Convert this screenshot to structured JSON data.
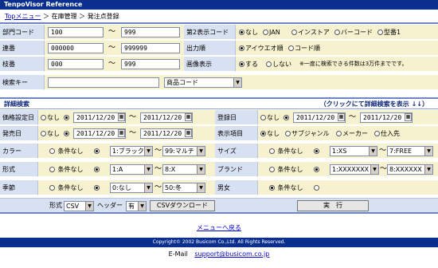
{
  "app_title": "TenpoVisor Reference",
  "breadcrumb": {
    "home": "Topメニュー",
    "sep1": "＞",
    "item1": "在庫管理",
    "sep2": "＞",
    "item2": "発注点登録"
  },
  "basic": {
    "dept": {
      "label": "部門コード",
      "from": "100",
      "tilde": "〜",
      "to": "999"
    },
    "serial": {
      "label": "連番",
      "from": "000000",
      "tilde": "〜",
      "to": "999999"
    },
    "trunk": {
      "label": "枝番",
      "from": "000",
      "tilde": "〜",
      "to": "999"
    },
    "search_key": {
      "label": "検索キー",
      "value": "",
      "select": "商品コード"
    },
    "second_code": {
      "label": "第2表示コード",
      "options": [
        "なし",
        "JAN",
        "インストア",
        "バーコード",
        "型番1"
      ],
      "selected": 0
    },
    "output_order": {
      "label": "出力順",
      "options": [
        "アイウエオ順",
        "コード順"
      ],
      "selected": 0
    },
    "image_display": {
      "label": "画像表示",
      "options": [
        "する",
        "しない"
      ],
      "selected": 0,
      "note": "※一度に検索できる件数は3万件までです。"
    }
  },
  "detail": {
    "title": "詳細検索",
    "toggle": "（クリックにて詳細検索を表示 ↓↓）",
    "price_date": {
      "label": "価格設定日",
      "none": "なし",
      "from": "2011/12/20",
      "tilde": "〜",
      "to": "2011/12/20",
      "selected": 1
    },
    "reg_date": {
      "label": "登録日",
      "none": "なし",
      "from": "2011/12/20",
      "tilde": "〜",
      "to": "2011/12/20",
      "selected": 1
    },
    "sale_date": {
      "label": "発売日",
      "none": "なし",
      "from": "2011/12/20",
      "tilde": "〜",
      "to": "2011/12/20",
      "selected": 1
    },
    "display_item": {
      "label": "表示項目",
      "options": [
        "なし",
        "サブジャンル",
        "メーカー",
        "仕入先"
      ],
      "selected": 0
    },
    "color": {
      "label": "カラー",
      "none": "条件なし",
      "from": "1:ブラック",
      "tilde": "〜",
      "to": "99:マルチ",
      "selected": 1
    },
    "size": {
      "label": "サイズ",
      "none": "条件なし",
      "from": "1:XS",
      "tilde": "〜",
      "to": "7:FREE",
      "selected": 1
    },
    "shape": {
      "label": "形式",
      "none": "条件なし",
      "from": "1:A",
      "tilde": "〜",
      "to": "8:X",
      "selected": 1
    },
    "brand": {
      "label": "ブランド",
      "none": "条件なし",
      "from": "1:XXXXXXX",
      "tilde": "〜",
      "to": "8:XXXXXX",
      "selected": 1
    },
    "season": {
      "label": "季節",
      "none": "条件なし",
      "from": "0:なし",
      "tilde": "〜",
      "to": "50:冬",
      "selected": 1
    },
    "gender": {
      "label": "男女",
      "none": "条件なし",
      "selected": 0
    }
  },
  "export": {
    "format_label": "形式",
    "format": "CSV",
    "header_label": "ヘッダー",
    "header": "有",
    "download": "CSVダウンロード",
    "run": "実　行"
  },
  "back_link": "メニューへ戻る",
  "copyright": "Copyright© 2002 Busicom Co.,Ltd. All Rights Reserved.",
  "contact": {
    "label": "E-Mail",
    "email": "support@busicom.co.jp"
  }
}
